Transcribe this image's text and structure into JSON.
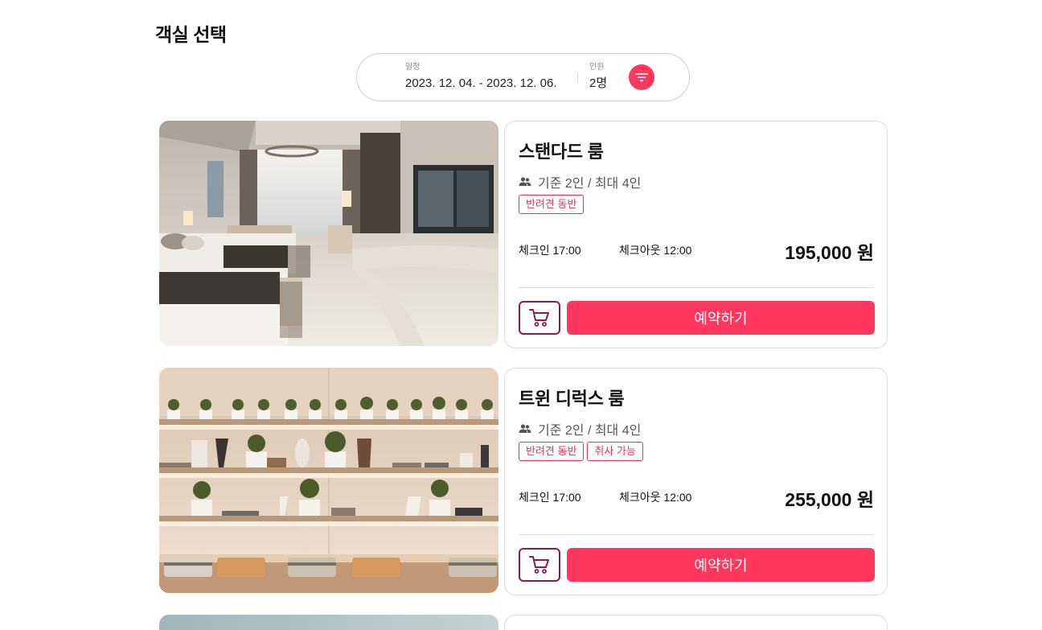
{
  "page": {
    "title": "객실 선택"
  },
  "search": {
    "date_label": "일정",
    "date_value": "2023. 12. 04. - 2023. 12. 06.",
    "guest_label": "인원",
    "guest_value": "2명",
    "filter_icon": "filter-icon"
  },
  "colors": {
    "accent": "#ff375f",
    "cart_border": "#8b1c4e",
    "tag": "#e8344f"
  },
  "rooms": [
    {
      "name": "스탠다드 룸",
      "capacity": "기준 2인 / 최대 4인",
      "tags": [
        "반려견 동반"
      ],
      "checkin": "체크인 17:00",
      "checkout": "체크아웃 12:00",
      "price": "195,000 원",
      "reserve_label": "예약하기"
    },
    {
      "name": "트윈 디럭스 룸",
      "capacity": "기준 2인 / 최대 4인",
      "tags": [
        "반려견 동반",
        "취사 가능"
      ],
      "checkin": "체크인 17:00",
      "checkout": "체크아웃 12:00",
      "price": "255,000 원",
      "reserve_label": "예약하기"
    }
  ]
}
